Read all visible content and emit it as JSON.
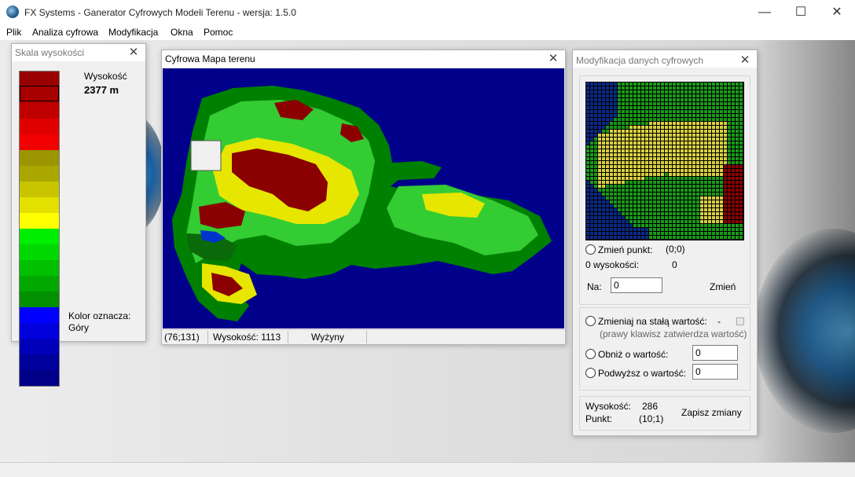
{
  "app": {
    "title": "FX Systems - Ganerator Cyfrowych Modeli Terenu - wersja: 1.5.0",
    "controls": {
      "minimize": "—",
      "maximize": "☐",
      "close": "✕"
    }
  },
  "menu": [
    "Plik",
    "Analiza cyfrowa",
    "Modyfikacja",
    "Okna",
    "Pomoc"
  ],
  "scale_window": {
    "title": "Skala wysokości",
    "height_label": "Wysokość",
    "height_value": "2377 m",
    "color_label_line1": "Kolor oznacza:",
    "color_label_line2": "Góry",
    "colors": [
      "#990000",
      "#a80000",
      "#c00000",
      "#e00000",
      "#f00000",
      "#9b9600",
      "#aaa800",
      "#c8c400",
      "#e4e000",
      "#ffff00",
      "#00ee00",
      "#00d800",
      "#00c000",
      "#00a800",
      "#009000",
      "#0000ff",
      "#0000dd",
      "#0000bb",
      "#00009c",
      "#000088"
    ]
  },
  "map_window": {
    "title": "Cyfrowa Mapa terenu",
    "status_coords": "(76;131)",
    "status_height": "Wysokość: 1113",
    "status_terrain": "Wyżyny",
    "colors": {
      "sea": "#00008b",
      "low": "#008000",
      "mid": "#28b828",
      "green": "#33cc33",
      "yellow": "#e6e600",
      "red": "#8b0000",
      "lake": "#0033cc"
    }
  },
  "mod_window": {
    "title": "Modyfikacja danych cyfrowych",
    "change_point_label": "Zmień punkt:",
    "change_point_coords": "(0;0)",
    "height_of_label": "0 wysokości:",
    "height_of_value": "0",
    "na_label": "Na:",
    "na_value": "0",
    "change_button": "Zmień",
    "constant_label": "Zmieniaj na stałą wartość:",
    "constant_value": "-",
    "constant_hint": "(prawy klawisz zatwierdza wartość)",
    "lower_label": "Obniż o wartość:",
    "lower_value": "0",
    "raise_label": "Podwyższ o wartość:",
    "raise_value": "0",
    "height_label": "Wysokość:",
    "height_value": "286",
    "point_label": "Punkt:",
    "point_value": "(10;1)",
    "save_button": "Zapisz zmiany"
  }
}
